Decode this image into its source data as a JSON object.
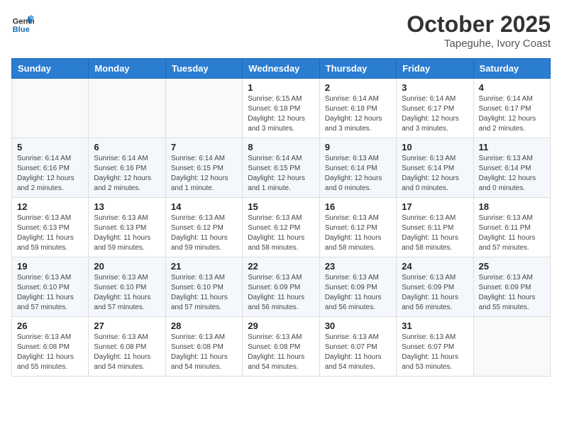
{
  "header": {
    "logo_line1": "General",
    "logo_line2": "Blue",
    "month_year": "October 2025",
    "location": "Tapeguhe, Ivory Coast"
  },
  "weekdays": [
    "Sunday",
    "Monday",
    "Tuesday",
    "Wednesday",
    "Thursday",
    "Friday",
    "Saturday"
  ],
  "weeks": [
    [
      {
        "day": "",
        "info": ""
      },
      {
        "day": "",
        "info": ""
      },
      {
        "day": "",
        "info": ""
      },
      {
        "day": "1",
        "info": "Sunrise: 6:15 AM\nSunset: 6:18 PM\nDaylight: 12 hours and 3 minutes."
      },
      {
        "day": "2",
        "info": "Sunrise: 6:14 AM\nSunset: 6:18 PM\nDaylight: 12 hours and 3 minutes."
      },
      {
        "day": "3",
        "info": "Sunrise: 6:14 AM\nSunset: 6:17 PM\nDaylight: 12 hours and 3 minutes."
      },
      {
        "day": "4",
        "info": "Sunrise: 6:14 AM\nSunset: 6:17 PM\nDaylight: 12 hours and 2 minutes."
      }
    ],
    [
      {
        "day": "5",
        "info": "Sunrise: 6:14 AM\nSunset: 6:16 PM\nDaylight: 12 hours and 2 minutes."
      },
      {
        "day": "6",
        "info": "Sunrise: 6:14 AM\nSunset: 6:16 PM\nDaylight: 12 hours and 2 minutes."
      },
      {
        "day": "7",
        "info": "Sunrise: 6:14 AM\nSunset: 6:15 PM\nDaylight: 12 hours and 1 minute."
      },
      {
        "day": "8",
        "info": "Sunrise: 6:14 AM\nSunset: 6:15 PM\nDaylight: 12 hours and 1 minute."
      },
      {
        "day": "9",
        "info": "Sunrise: 6:13 AM\nSunset: 6:14 PM\nDaylight: 12 hours and 0 minutes."
      },
      {
        "day": "10",
        "info": "Sunrise: 6:13 AM\nSunset: 6:14 PM\nDaylight: 12 hours and 0 minutes."
      },
      {
        "day": "11",
        "info": "Sunrise: 6:13 AM\nSunset: 6:14 PM\nDaylight: 12 hours and 0 minutes."
      }
    ],
    [
      {
        "day": "12",
        "info": "Sunrise: 6:13 AM\nSunset: 6:13 PM\nDaylight: 11 hours and 59 minutes."
      },
      {
        "day": "13",
        "info": "Sunrise: 6:13 AM\nSunset: 6:13 PM\nDaylight: 11 hours and 59 minutes."
      },
      {
        "day": "14",
        "info": "Sunrise: 6:13 AM\nSunset: 6:12 PM\nDaylight: 11 hours and 59 minutes."
      },
      {
        "day": "15",
        "info": "Sunrise: 6:13 AM\nSunset: 6:12 PM\nDaylight: 11 hours and 58 minutes."
      },
      {
        "day": "16",
        "info": "Sunrise: 6:13 AM\nSunset: 6:12 PM\nDaylight: 11 hours and 58 minutes."
      },
      {
        "day": "17",
        "info": "Sunrise: 6:13 AM\nSunset: 6:11 PM\nDaylight: 11 hours and 58 minutes."
      },
      {
        "day": "18",
        "info": "Sunrise: 6:13 AM\nSunset: 6:11 PM\nDaylight: 11 hours and 57 minutes."
      }
    ],
    [
      {
        "day": "19",
        "info": "Sunrise: 6:13 AM\nSunset: 6:10 PM\nDaylight: 11 hours and 57 minutes."
      },
      {
        "day": "20",
        "info": "Sunrise: 6:13 AM\nSunset: 6:10 PM\nDaylight: 11 hours and 57 minutes."
      },
      {
        "day": "21",
        "info": "Sunrise: 6:13 AM\nSunset: 6:10 PM\nDaylight: 11 hours and 57 minutes."
      },
      {
        "day": "22",
        "info": "Sunrise: 6:13 AM\nSunset: 6:09 PM\nDaylight: 11 hours and 56 minutes."
      },
      {
        "day": "23",
        "info": "Sunrise: 6:13 AM\nSunset: 6:09 PM\nDaylight: 11 hours and 56 minutes."
      },
      {
        "day": "24",
        "info": "Sunrise: 6:13 AM\nSunset: 6:09 PM\nDaylight: 11 hours and 56 minutes."
      },
      {
        "day": "25",
        "info": "Sunrise: 6:13 AM\nSunset: 6:09 PM\nDaylight: 11 hours and 55 minutes."
      }
    ],
    [
      {
        "day": "26",
        "info": "Sunrise: 6:13 AM\nSunset: 6:08 PM\nDaylight: 11 hours and 55 minutes."
      },
      {
        "day": "27",
        "info": "Sunrise: 6:13 AM\nSunset: 6:08 PM\nDaylight: 11 hours and 54 minutes."
      },
      {
        "day": "28",
        "info": "Sunrise: 6:13 AM\nSunset: 6:08 PM\nDaylight: 11 hours and 54 minutes."
      },
      {
        "day": "29",
        "info": "Sunrise: 6:13 AM\nSunset: 6:08 PM\nDaylight: 11 hours and 54 minutes."
      },
      {
        "day": "30",
        "info": "Sunrise: 6:13 AM\nSunset: 6:07 PM\nDaylight: 11 hours and 54 minutes."
      },
      {
        "day": "31",
        "info": "Sunrise: 6:13 AM\nSunset: 6:07 PM\nDaylight: 11 hours and 53 minutes."
      },
      {
        "day": "",
        "info": ""
      }
    ]
  ]
}
